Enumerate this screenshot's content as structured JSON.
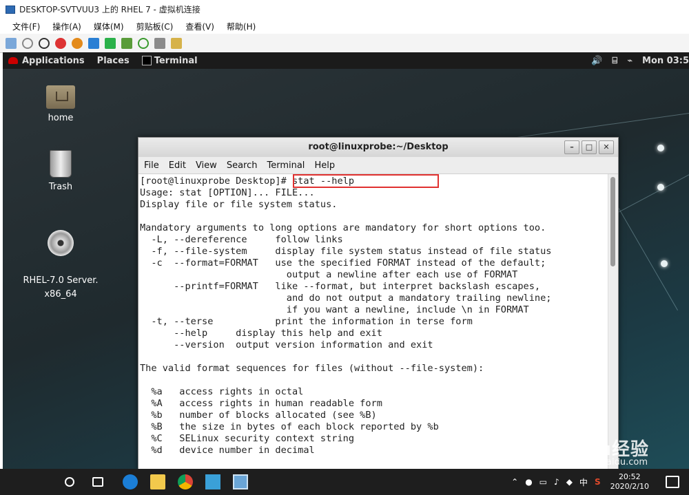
{
  "host": {
    "title": "DESKTOP-SVTVUU3 上的 RHEL 7 - 虚拟机连接",
    "menu": [
      "文件(F)",
      "操作(A)",
      "媒体(M)",
      "剪贴板(C)",
      "查看(V)",
      "帮助(H)"
    ]
  },
  "gnome": {
    "applications": "Applications",
    "places": "Places",
    "terminal_task": "Terminal",
    "clock": "Mon 03:5"
  },
  "desktop_icons": [
    {
      "label": "home"
    },
    {
      "label": "Trash"
    },
    {
      "label": "RHEL-7.0 Server.\nx86_64"
    }
  ],
  "terminal": {
    "title": "root@linuxprobe:~/Desktop",
    "menu": [
      "File",
      "Edit",
      "View",
      "Search",
      "Terminal",
      "Help"
    ],
    "output": "[root@linuxprobe Desktop]# stat --help\nUsage: stat [OPTION]... FILE...\nDisplay file or file system status.\n\nMandatory arguments to long options are mandatory for short options too.\n  -L, --dereference     follow links\n  -f, --file-system     display file system status instead of file status\n  -c  --format=FORMAT   use the specified FORMAT instead of the default;\n                          output a newline after each use of FORMAT\n      --printf=FORMAT   like --format, but interpret backslash escapes,\n                          and do not output a mandatory trailing newline;\n                          if you want a newline, include \\n in FORMAT\n  -t, --terse           print the information in terse form\n      --help     display this help and exit\n      --version  output version information and exit\n\nThe valid format sequences for files (without --file-system):\n\n  %a   access rights in octal\n  %A   access rights in human readable form\n  %b   number of blocks allocated (see %B)\n  %B   the size in bytes of each block reported by %b\n  %C   SELinux security context string\n  %d   device number in decimal"
  },
  "taskbar": {
    "ime": "中",
    "time": "20:52",
    "date": "2020/2/10"
  },
  "watermark": {
    "brand": "Baidu经验",
    "url": "jingyan.baidu.com"
  }
}
